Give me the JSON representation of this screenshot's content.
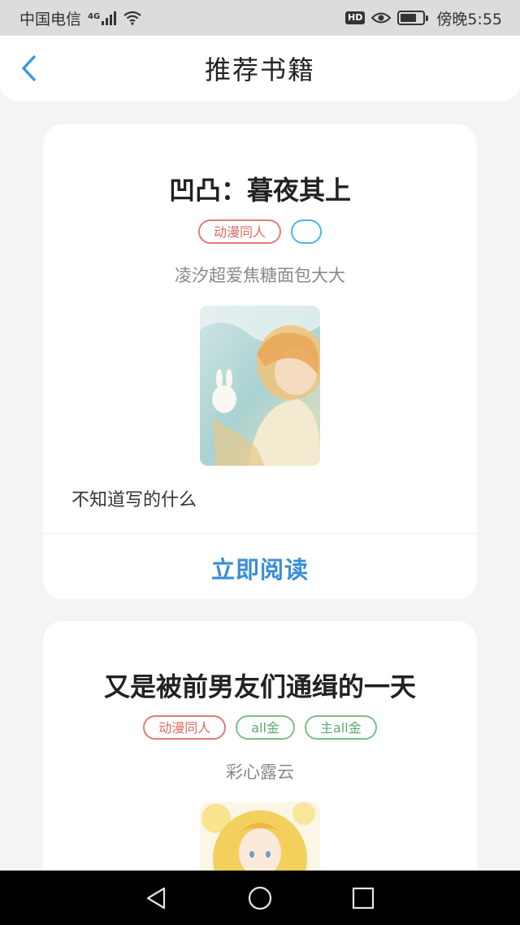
{
  "status_bar": {
    "carrier": "中国电信",
    "network": "4G",
    "time": "傍晚5:55",
    "hd": "HD"
  },
  "header": {
    "title": "推荐书籍",
    "back_icon": "chevron-left-icon"
  },
  "books": [
    {
      "title": "凹凸：暮夜其上",
      "tags": [
        "动漫同人",
        ""
      ],
      "author": "凌汐超爱焦糖面包大大",
      "description": "不知道写的什么",
      "read_label": "立即阅读"
    },
    {
      "title": "又是被前男友们通缉的一天",
      "tags": [
        "动漫同人",
        "all金",
        "主all金"
      ],
      "author": "彩心露云"
    }
  ],
  "colors": {
    "accent": "#3a8ed8",
    "tag_red": "#d86b66",
    "tag_green": "#5caa72",
    "tag_blue": "#4cb6e0"
  },
  "nav": {
    "back_icon": "triangle-back-icon",
    "home_icon": "circle-home-icon",
    "recents_icon": "square-recents-icon"
  }
}
